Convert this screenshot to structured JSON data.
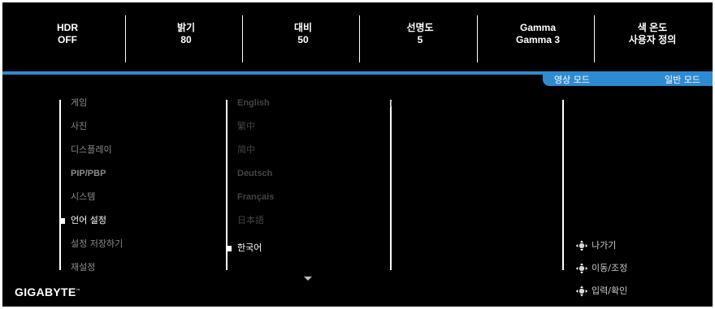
{
  "status_bar": [
    {
      "label": "HDR",
      "value": "OFF"
    },
    {
      "label": "밝기",
      "value": "80"
    },
    {
      "label": "대비",
      "value": "50"
    },
    {
      "label": "선명도",
      "value": "5"
    },
    {
      "label": "Gamma",
      "value": "Gamma 3"
    },
    {
      "label": "색 온도",
      "value": "사용자 정의"
    }
  ],
  "tabs": {
    "picture_mode": "영상 모드",
    "standard_mode": "일반 모드"
  },
  "main_menu": [
    "게임",
    "사진",
    "디스플레이",
    "PIP/PBP",
    "시스템",
    "언어 설정",
    "설정 저장하기",
    "재설정"
  ],
  "selected_main_index": 5,
  "languages": [
    "English",
    "繁中",
    "简中",
    "Deutsch",
    "Français",
    "日本語",
    "한국어"
  ],
  "selected_language": "한국어",
  "hints": {
    "exit": "나가기",
    "move_adjust": "이동/조정",
    "enter_confirm": "입력/확인"
  },
  "brand": {
    "name": "GIGABYTE",
    "tm": "™"
  },
  "colors": {
    "accent": "#2e8bd1",
    "background": "#000000",
    "text_active": "#ffffff",
    "text_inactive": "#8a8a8a",
    "text_disabled": "#444444"
  },
  "icons": {
    "hint_icon": "joystick-direction-icon",
    "scroll": "chevron-down-icon"
  }
}
